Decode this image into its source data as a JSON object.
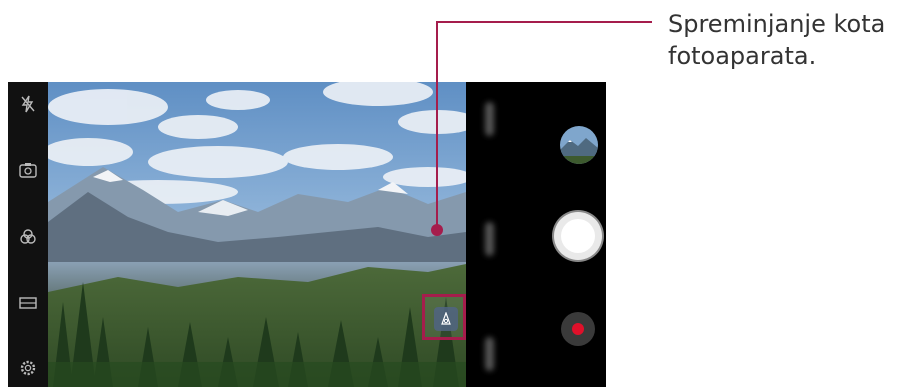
{
  "callout": {
    "line1": "Spreminjanje kota",
    "line2": "fotoaparata."
  },
  "colors": {
    "accent": "#a51d4c",
    "record": "#e0102a"
  },
  "icons": {
    "left_bar": [
      "flash-off-icon",
      "switch-camera-icon",
      "filter-icon",
      "aspect-ratio-icon",
      "settings-icon"
    ],
    "viewfinder": [
      "camera-angle-icon"
    ],
    "right_panel": [
      "gallery-thumbnail",
      "shutter-button",
      "record-button"
    ]
  }
}
